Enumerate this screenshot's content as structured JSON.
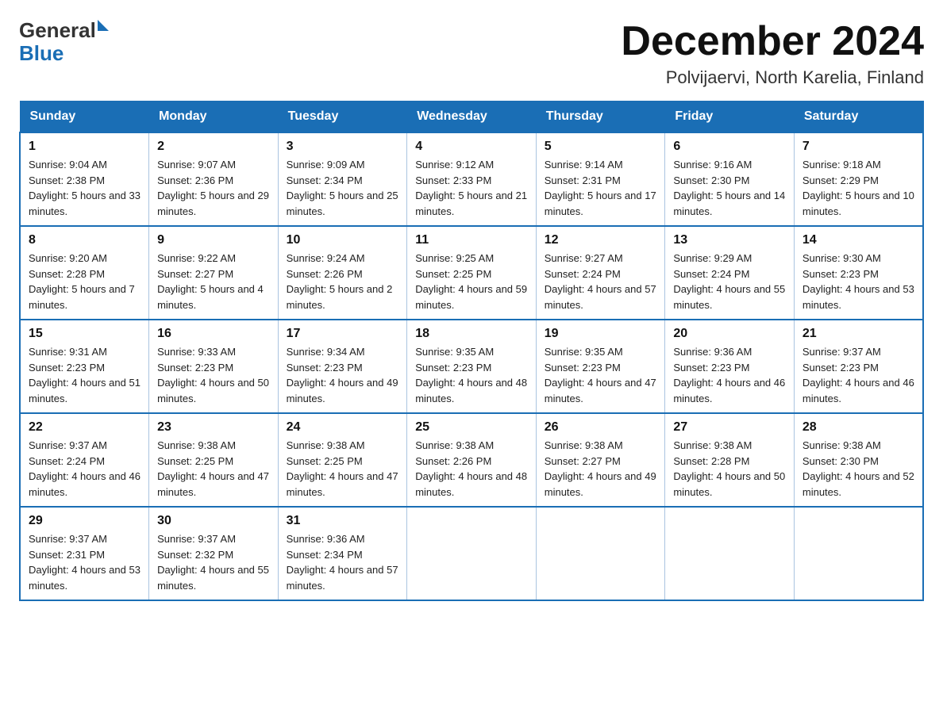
{
  "header": {
    "logo_general": "General",
    "logo_blue": "Blue",
    "title": "December 2024",
    "subtitle": "Polvijaervi, North Karelia, Finland"
  },
  "days_of_week": [
    "Sunday",
    "Monday",
    "Tuesday",
    "Wednesday",
    "Thursday",
    "Friday",
    "Saturday"
  ],
  "weeks": [
    [
      {
        "day": "1",
        "sunrise": "Sunrise: 9:04 AM",
        "sunset": "Sunset: 2:38 PM",
        "daylight": "Daylight: 5 hours and 33 minutes."
      },
      {
        "day": "2",
        "sunrise": "Sunrise: 9:07 AM",
        "sunset": "Sunset: 2:36 PM",
        "daylight": "Daylight: 5 hours and 29 minutes."
      },
      {
        "day": "3",
        "sunrise": "Sunrise: 9:09 AM",
        "sunset": "Sunset: 2:34 PM",
        "daylight": "Daylight: 5 hours and 25 minutes."
      },
      {
        "day": "4",
        "sunrise": "Sunrise: 9:12 AM",
        "sunset": "Sunset: 2:33 PM",
        "daylight": "Daylight: 5 hours and 21 minutes."
      },
      {
        "day": "5",
        "sunrise": "Sunrise: 9:14 AM",
        "sunset": "Sunset: 2:31 PM",
        "daylight": "Daylight: 5 hours and 17 minutes."
      },
      {
        "day": "6",
        "sunrise": "Sunrise: 9:16 AM",
        "sunset": "Sunset: 2:30 PM",
        "daylight": "Daylight: 5 hours and 14 minutes."
      },
      {
        "day": "7",
        "sunrise": "Sunrise: 9:18 AM",
        "sunset": "Sunset: 2:29 PM",
        "daylight": "Daylight: 5 hours and 10 minutes."
      }
    ],
    [
      {
        "day": "8",
        "sunrise": "Sunrise: 9:20 AM",
        "sunset": "Sunset: 2:28 PM",
        "daylight": "Daylight: 5 hours and 7 minutes."
      },
      {
        "day": "9",
        "sunrise": "Sunrise: 9:22 AM",
        "sunset": "Sunset: 2:27 PM",
        "daylight": "Daylight: 5 hours and 4 minutes."
      },
      {
        "day": "10",
        "sunrise": "Sunrise: 9:24 AM",
        "sunset": "Sunset: 2:26 PM",
        "daylight": "Daylight: 5 hours and 2 minutes."
      },
      {
        "day": "11",
        "sunrise": "Sunrise: 9:25 AM",
        "sunset": "Sunset: 2:25 PM",
        "daylight": "Daylight: 4 hours and 59 minutes."
      },
      {
        "day": "12",
        "sunrise": "Sunrise: 9:27 AM",
        "sunset": "Sunset: 2:24 PM",
        "daylight": "Daylight: 4 hours and 57 minutes."
      },
      {
        "day": "13",
        "sunrise": "Sunrise: 9:29 AM",
        "sunset": "Sunset: 2:24 PM",
        "daylight": "Daylight: 4 hours and 55 minutes."
      },
      {
        "day": "14",
        "sunrise": "Sunrise: 9:30 AM",
        "sunset": "Sunset: 2:23 PM",
        "daylight": "Daylight: 4 hours and 53 minutes."
      }
    ],
    [
      {
        "day": "15",
        "sunrise": "Sunrise: 9:31 AM",
        "sunset": "Sunset: 2:23 PM",
        "daylight": "Daylight: 4 hours and 51 minutes."
      },
      {
        "day": "16",
        "sunrise": "Sunrise: 9:33 AM",
        "sunset": "Sunset: 2:23 PM",
        "daylight": "Daylight: 4 hours and 50 minutes."
      },
      {
        "day": "17",
        "sunrise": "Sunrise: 9:34 AM",
        "sunset": "Sunset: 2:23 PM",
        "daylight": "Daylight: 4 hours and 49 minutes."
      },
      {
        "day": "18",
        "sunrise": "Sunrise: 9:35 AM",
        "sunset": "Sunset: 2:23 PM",
        "daylight": "Daylight: 4 hours and 48 minutes."
      },
      {
        "day": "19",
        "sunrise": "Sunrise: 9:35 AM",
        "sunset": "Sunset: 2:23 PM",
        "daylight": "Daylight: 4 hours and 47 minutes."
      },
      {
        "day": "20",
        "sunrise": "Sunrise: 9:36 AM",
        "sunset": "Sunset: 2:23 PM",
        "daylight": "Daylight: 4 hours and 46 minutes."
      },
      {
        "day": "21",
        "sunrise": "Sunrise: 9:37 AM",
        "sunset": "Sunset: 2:23 PM",
        "daylight": "Daylight: 4 hours and 46 minutes."
      }
    ],
    [
      {
        "day": "22",
        "sunrise": "Sunrise: 9:37 AM",
        "sunset": "Sunset: 2:24 PM",
        "daylight": "Daylight: 4 hours and 46 minutes."
      },
      {
        "day": "23",
        "sunrise": "Sunrise: 9:38 AM",
        "sunset": "Sunset: 2:25 PM",
        "daylight": "Daylight: 4 hours and 47 minutes."
      },
      {
        "day": "24",
        "sunrise": "Sunrise: 9:38 AM",
        "sunset": "Sunset: 2:25 PM",
        "daylight": "Daylight: 4 hours and 47 minutes."
      },
      {
        "day": "25",
        "sunrise": "Sunrise: 9:38 AM",
        "sunset": "Sunset: 2:26 PM",
        "daylight": "Daylight: 4 hours and 48 minutes."
      },
      {
        "day": "26",
        "sunrise": "Sunrise: 9:38 AM",
        "sunset": "Sunset: 2:27 PM",
        "daylight": "Daylight: 4 hours and 49 minutes."
      },
      {
        "day": "27",
        "sunrise": "Sunrise: 9:38 AM",
        "sunset": "Sunset: 2:28 PM",
        "daylight": "Daylight: 4 hours and 50 minutes."
      },
      {
        "day": "28",
        "sunrise": "Sunrise: 9:38 AM",
        "sunset": "Sunset: 2:30 PM",
        "daylight": "Daylight: 4 hours and 52 minutes."
      }
    ],
    [
      {
        "day": "29",
        "sunrise": "Sunrise: 9:37 AM",
        "sunset": "Sunset: 2:31 PM",
        "daylight": "Daylight: 4 hours and 53 minutes."
      },
      {
        "day": "30",
        "sunrise": "Sunrise: 9:37 AM",
        "sunset": "Sunset: 2:32 PM",
        "daylight": "Daylight: 4 hours and 55 minutes."
      },
      {
        "day": "31",
        "sunrise": "Sunrise: 9:36 AM",
        "sunset": "Sunset: 2:34 PM",
        "daylight": "Daylight: 4 hours and 57 minutes."
      },
      null,
      null,
      null,
      null
    ]
  ]
}
